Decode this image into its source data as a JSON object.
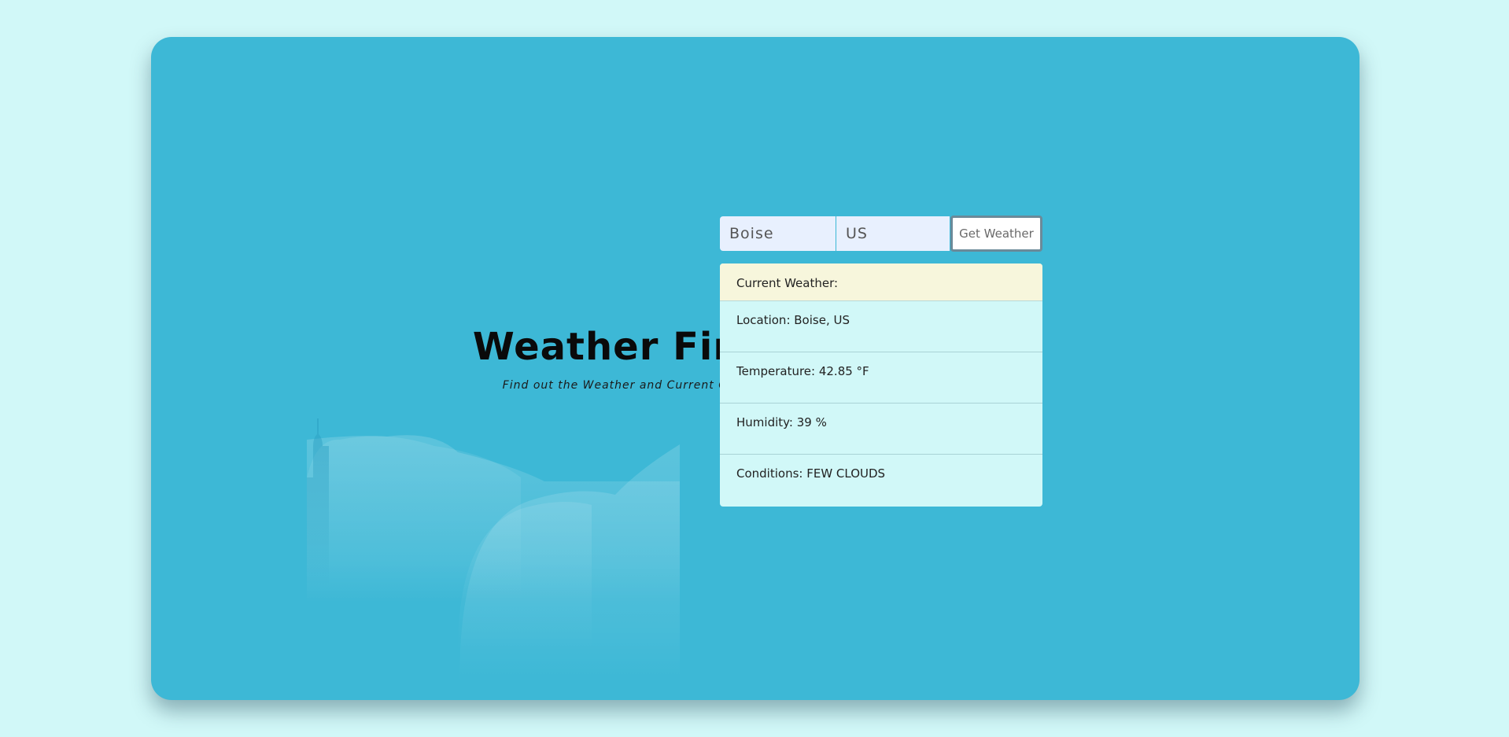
{
  "header": {
    "title": "Weather Finder",
    "subtitle": "Find out the Weather and Current Conditions"
  },
  "form": {
    "city_value": "Boise",
    "country_value": "US",
    "submit_label": "Get Weather"
  },
  "results": {
    "heading": "Current Weather:",
    "rows": [
      {
        "label": "Location: Boise, US"
      },
      {
        "label": "Temperature: 42.85 °F"
      },
      {
        "label": "Humidity: 39 %"
      },
      {
        "label": "Conditions: FEW CLOUDS"
      }
    ]
  },
  "colors": {
    "page_background": "#d1f8f8",
    "card_background": "#3db8d6",
    "results_header": "#f7f6dc",
    "results_body": "#d1f8f8",
    "input_background": "#e8f0fe"
  }
}
